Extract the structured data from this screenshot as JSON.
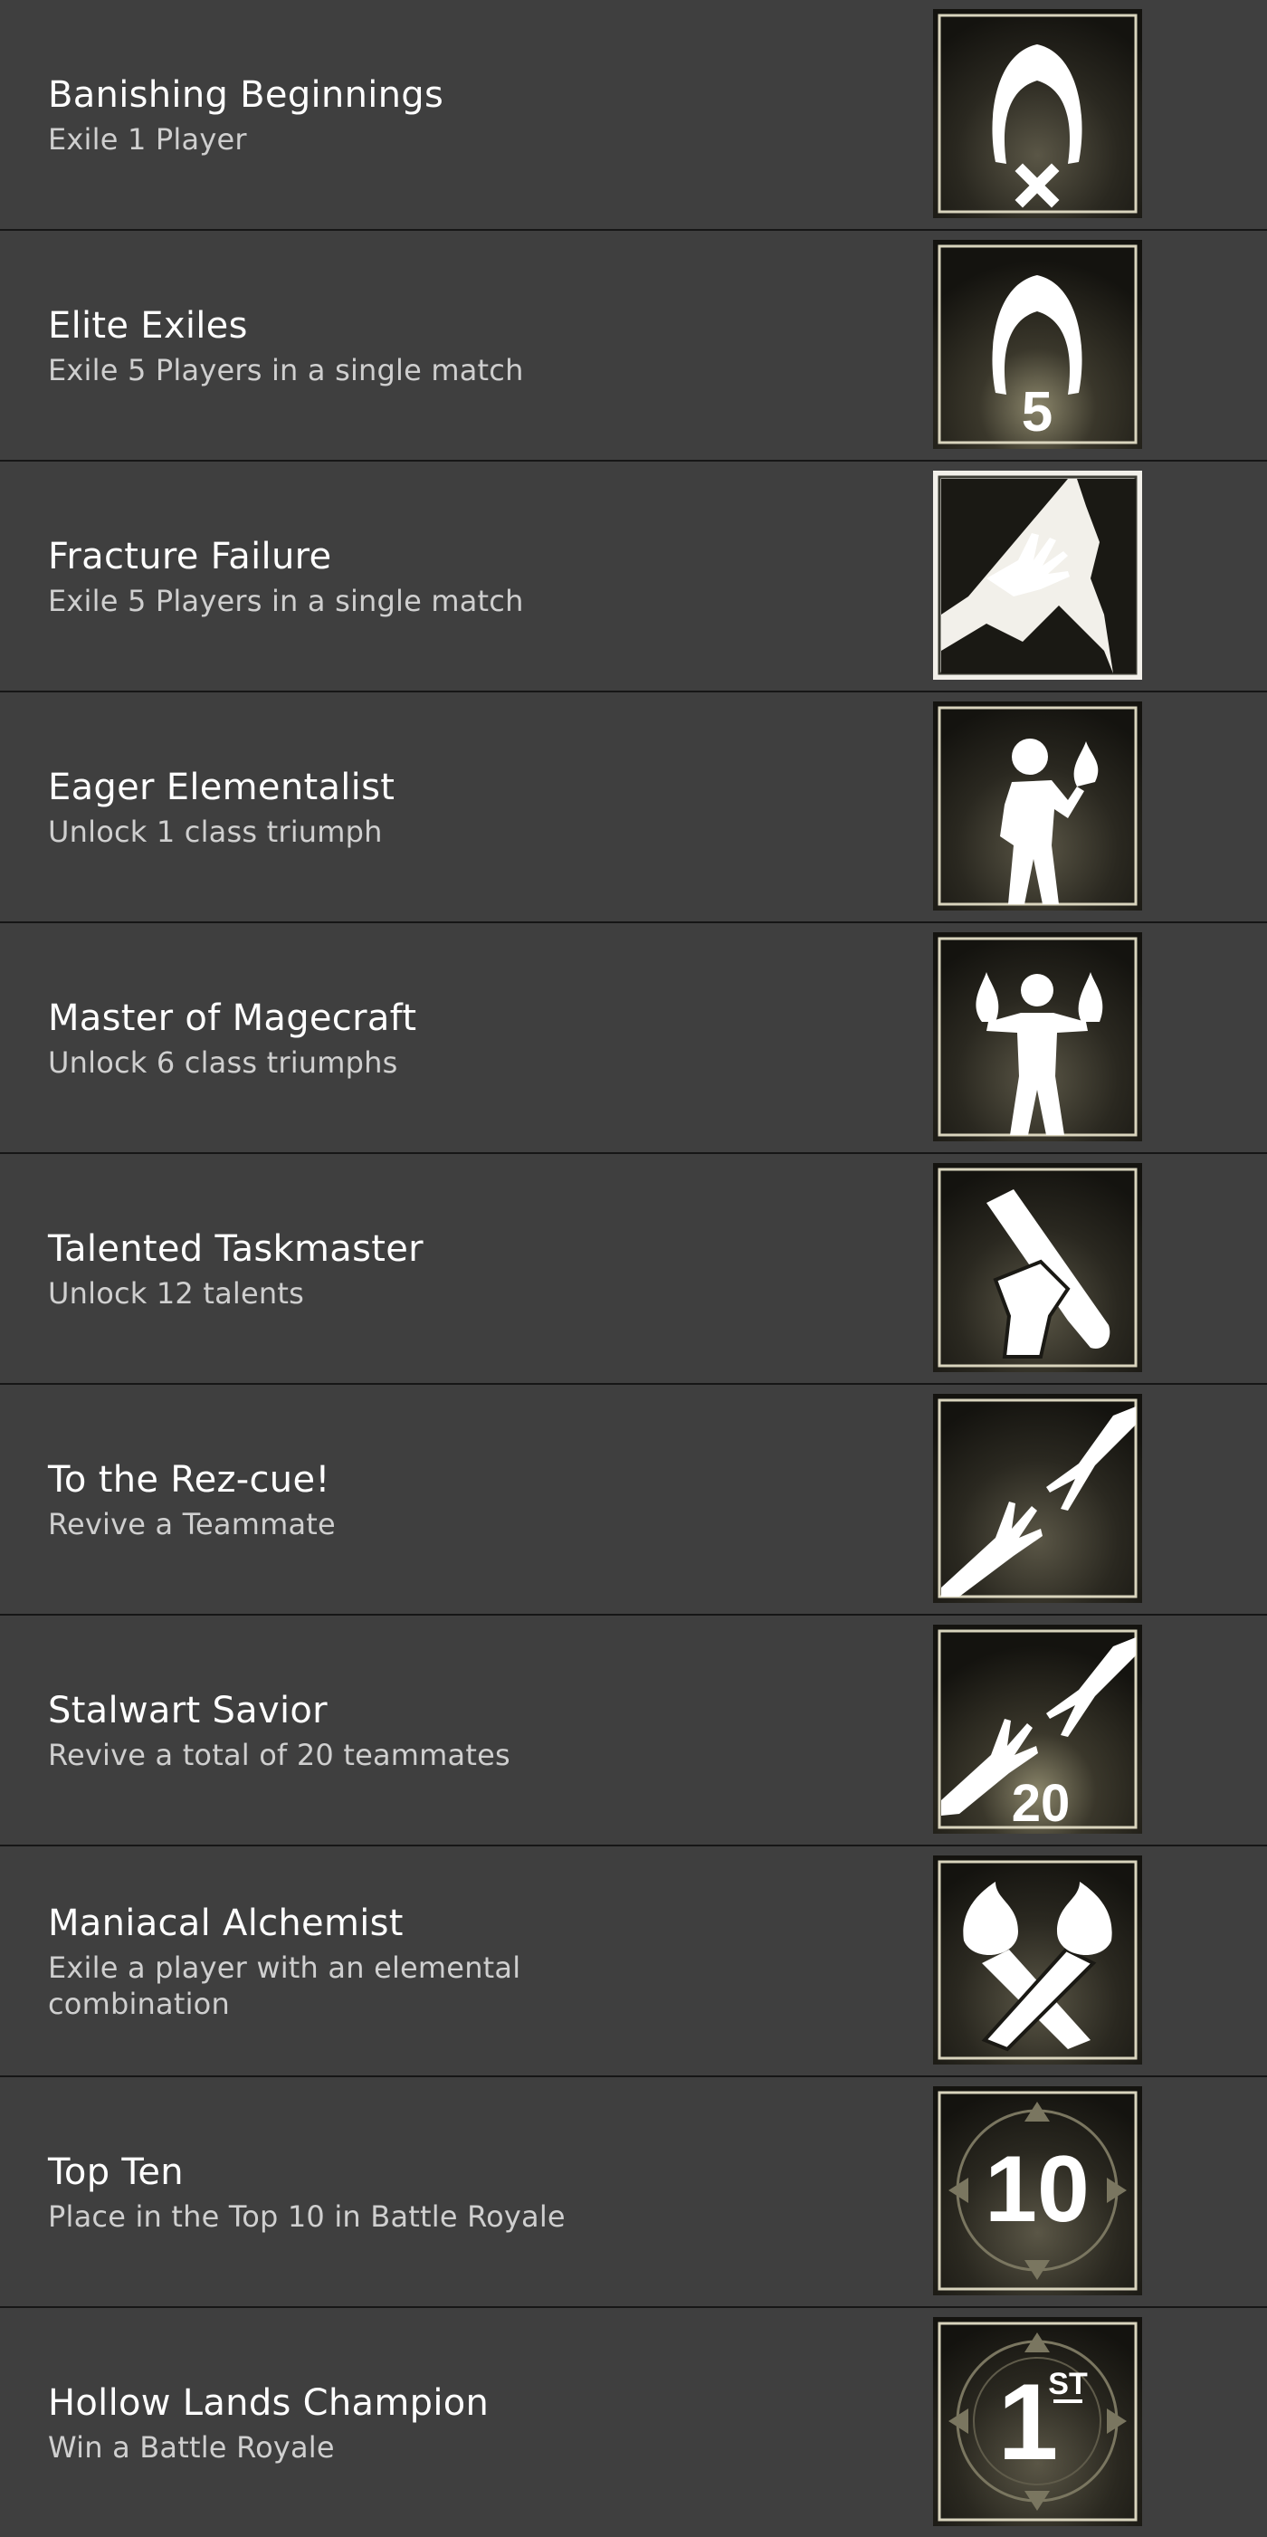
{
  "achievements": [
    {
      "title": "Banishing Beginnings",
      "description": "Exile 1 Player",
      "icon": "hood-exile-icon"
    },
    {
      "title": "Elite Exiles",
      "description": "Exile 5 Players in a single match",
      "icon": "hood-five-icon",
      "badge_text": "5"
    },
    {
      "title": "Fracture  Failure",
      "description": "Exile 5 Players in a single match",
      "icon": "falling-hand-icon"
    },
    {
      "title": "Eager Elementalist",
      "description": "Unlock 1 class triumph",
      "icon": "elementalist-icon"
    },
    {
      "title": "Master of Magecraft",
      "description": "Unlock 6 class triumphs",
      "icon": "mage-icon"
    },
    {
      "title": "Talented Taskmaster",
      "description": "Unlock 12 talents",
      "icon": "scroll-icon"
    },
    {
      "title": "To the Rez-cue!",
      "description": "Revive a Teammate",
      "icon": "reaching-hands-icon"
    },
    {
      "title": "Stalwart Savior",
      "description": "Revive a total of 20 teammates",
      "icon": "reaching-hands-twenty-icon",
      "badge_text": "20"
    },
    {
      "title": "Maniacal Alchemist",
      "description": "Exile a player with an elemental\ncombination",
      "icon": "flaming-fists-icon"
    },
    {
      "title": "Top Ten",
      "description": "Place in the Top 10 in Battle Royale",
      "icon": "top-ten-icon",
      "badge_text": "10"
    },
    {
      "title": "Hollow Lands Champion",
      "description": "Win a Battle Royale",
      "icon": "first-place-icon",
      "badge_text": "1",
      "badge_sup": "ST"
    }
  ],
  "colors": {
    "row_bg": "#3f3f3f",
    "divider": "#161616",
    "title": "#ffffff",
    "description": "#cfcfcf",
    "badge_bg": "#1a1914",
    "badge_frame": "#d9d4bd",
    "icon_fill": "#ffffff"
  }
}
